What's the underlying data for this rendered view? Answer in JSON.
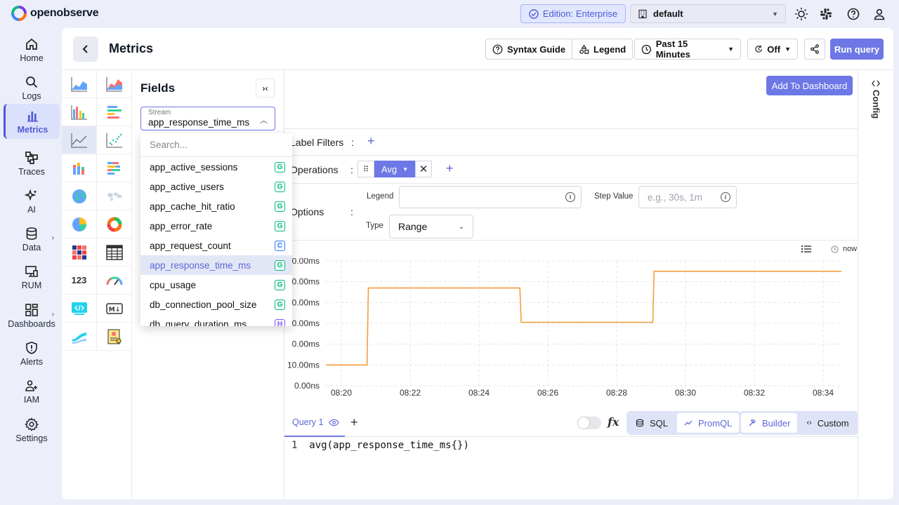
{
  "app": {
    "logo_text": "openobserve"
  },
  "topbar": {
    "edition": "Edition: Enterprise",
    "org": "default"
  },
  "nav": [
    {
      "label": "Home",
      "icon": "home-icon"
    },
    {
      "label": "Logs",
      "icon": "search-icon"
    },
    {
      "label": "Metrics",
      "icon": "bar-chart-icon",
      "active": true
    },
    {
      "label": "Traces",
      "icon": "traces-icon"
    },
    {
      "label": "AI",
      "icon": "sparkle-icon"
    },
    {
      "label": "Data",
      "icon": "database-icon"
    },
    {
      "label": "RUM",
      "icon": "monitor-icon"
    },
    {
      "label": "Dashboards",
      "icon": "dashboard-icon"
    },
    {
      "label": "Alerts",
      "icon": "shield-alert-icon"
    },
    {
      "label": "IAM",
      "icon": "users-icon"
    },
    {
      "label": "Settings",
      "icon": "gear-icon"
    }
  ],
  "header": {
    "title": "Metrics",
    "syntax_guide": "Syntax Guide",
    "legend": "Legend",
    "time_range": "Past 15 Minutes",
    "refresh": "Off",
    "run_query": "Run query"
  },
  "fields": {
    "title": "Fields",
    "stream_label": "Stream",
    "stream_value": "app_response_time_ms",
    "search_placeholder": "Search...",
    "streams": [
      {
        "name": "app_active_sessions",
        "type": "G"
      },
      {
        "name": "app_active_users",
        "type": "G"
      },
      {
        "name": "app_cache_hit_ratio",
        "type": "G"
      },
      {
        "name": "app_error_rate",
        "type": "G"
      },
      {
        "name": "app_request_count",
        "type": "C"
      },
      {
        "name": "app_response_time_ms",
        "type": "G",
        "selected": true
      },
      {
        "name": "cpu_usage",
        "type": "G"
      },
      {
        "name": "db_connection_pool_size",
        "type": "G"
      },
      {
        "name": "db_query_duration_ms",
        "type": "H"
      }
    ]
  },
  "query_builder": {
    "add_to_dashboard": "Add To Dashboard",
    "label_filters": "Label Filters",
    "operations": "Operations",
    "operation_chip": "Avg",
    "options": "Options",
    "legend_label": "Legend",
    "step_label": "Step Value",
    "step_placeholder": "e.g., 30s, 1m",
    "type_label": "Type",
    "type_value": "Range",
    "colon": ":"
  },
  "chart_tools": {
    "now": "now"
  },
  "chart_data": {
    "type": "line",
    "x_ticks": [
      "08:20",
      "08:22",
      "08:24",
      "08:26",
      "08:28",
      "08:30",
      "08:32",
      "08:34"
    ],
    "y_ticks": [
      "0.00ns",
      "10.00ms",
      "0.00ms",
      "0.00ms",
      "0.00ms",
      "0.00ms",
      "0.00ms"
    ],
    "series": [
      {
        "color": "#f59e3b",
        "points": [
          {
            "t": 0,
            "v": 1
          },
          {
            "t": 1.55,
            "v": 1
          },
          {
            "t": 1.6,
            "v": 4.7
          },
          {
            "t": 7.3,
            "v": 4.7
          },
          {
            "t": 7.35,
            "v": 3.05
          },
          {
            "t": 12.3,
            "v": 3.05
          },
          {
            "t": 12.35,
            "v": 5.5
          },
          {
            "t": 19.4,
            "v": 5.5
          }
        ]
      }
    ]
  },
  "query_bar": {
    "tab": "Query 1",
    "sql": "SQL",
    "promql": "PromQL",
    "builder": "Builder",
    "custom": "Custom",
    "line_no": "1",
    "code": "avg(app_response_time_ms{})"
  },
  "config": {
    "label": "Config"
  }
}
